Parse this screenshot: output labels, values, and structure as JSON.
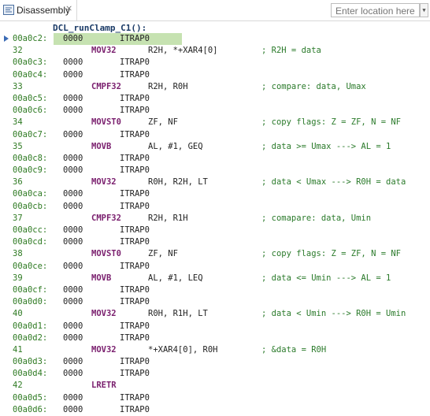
{
  "tab": {
    "label": "Disassembly",
    "close_icon": "close-icon"
  },
  "location": {
    "placeholder": "Enter location here"
  },
  "function_label": "DCL_runClamp_C1():",
  "colors": {
    "address": "#2e7a22",
    "mnemonic": "#7a1f6e",
    "comment": "#2a7a2a",
    "highlight": "#c6e2b1"
  },
  "rows": [
    {
      "kind": "addr",
      "text": "00a0c2:",
      "op": "0000",
      "instr": "ITRAP0",
      "current": true
    },
    {
      "kind": "src",
      "text": "32",
      "mn": "MOV32",
      "args": "R2H, *+XAR4[0]",
      "cmt": "; R2H = data"
    },
    {
      "kind": "addr",
      "text": "00a0c3:",
      "op": "0000",
      "instr": "ITRAP0"
    },
    {
      "kind": "addr",
      "text": "00a0c4:",
      "op": "0000",
      "instr": "ITRAP0"
    },
    {
      "kind": "src",
      "text": "33",
      "mn": "CMPF32",
      "args": "R2H, R0H",
      "cmt": "; compare: data, Umax"
    },
    {
      "kind": "addr",
      "text": "00a0c5:",
      "op": "0000",
      "instr": "ITRAP0"
    },
    {
      "kind": "addr",
      "text": "00a0c6:",
      "op": "0000",
      "instr": "ITRAP0"
    },
    {
      "kind": "src",
      "text": "34",
      "mn": "MOVST0",
      "args": "ZF, NF",
      "cmt": "; copy flags: Z = ZF, N = NF"
    },
    {
      "kind": "addr",
      "text": "00a0c7:",
      "op": "0000",
      "instr": "ITRAP0"
    },
    {
      "kind": "src",
      "text": "35",
      "mn": "MOVB",
      "args": "AL, #1, GEQ",
      "cmt": "; data >= Umax ---> AL = 1"
    },
    {
      "kind": "addr",
      "text": "00a0c8:",
      "op": "0000",
      "instr": "ITRAP0"
    },
    {
      "kind": "addr",
      "text": "00a0c9:",
      "op": "0000",
      "instr": "ITRAP0"
    },
    {
      "kind": "src",
      "text": "36",
      "mn": "MOV32",
      "args": "R0H, R2H, LT",
      "cmt": "; data < Umax ---> R0H = data"
    },
    {
      "kind": "addr",
      "text": "00a0ca:",
      "op": "0000",
      "instr": "ITRAP0"
    },
    {
      "kind": "addr",
      "text": "00a0cb:",
      "op": "0000",
      "instr": "ITRAP0"
    },
    {
      "kind": "src",
      "text": "37",
      "mn": "CMPF32",
      "args": "R2H, R1H",
      "cmt": "; comapare: data, Umin"
    },
    {
      "kind": "addr",
      "text": "00a0cc:",
      "op": "0000",
      "instr": "ITRAP0"
    },
    {
      "kind": "addr",
      "text": "00a0cd:",
      "op": "0000",
      "instr": "ITRAP0"
    },
    {
      "kind": "src",
      "text": "38",
      "mn": "MOVST0",
      "args": "ZF, NF",
      "cmt": "; copy flags: Z = ZF, N = NF"
    },
    {
      "kind": "addr",
      "text": "00a0ce:",
      "op": "0000",
      "instr": "ITRAP0"
    },
    {
      "kind": "src",
      "text": "39",
      "mn": "MOVB",
      "args": "AL, #1, LEQ",
      "cmt": "; data <= Umin ---> AL = 1"
    },
    {
      "kind": "addr",
      "text": "00a0cf:",
      "op": "0000",
      "instr": "ITRAP0"
    },
    {
      "kind": "addr",
      "text": "00a0d0:",
      "op": "0000",
      "instr": "ITRAP0"
    },
    {
      "kind": "src",
      "text": "40",
      "mn": "MOV32",
      "args": "R0H, R1H, LT",
      "cmt": "; data < Umin ---> R0H = Umin"
    },
    {
      "kind": "addr",
      "text": "00a0d1:",
      "op": "0000",
      "instr": "ITRAP0"
    },
    {
      "kind": "addr",
      "text": "00a0d2:",
      "op": "0000",
      "instr": "ITRAP0"
    },
    {
      "kind": "src",
      "text": "41",
      "mn": "MOV32",
      "args": "*+XAR4[0], R0H",
      "cmt": "; &data = R0H"
    },
    {
      "kind": "addr",
      "text": "00a0d3:",
      "op": "0000",
      "instr": "ITRAP0"
    },
    {
      "kind": "addr",
      "text": "00a0d4:",
      "op": "0000",
      "instr": "ITRAP0"
    },
    {
      "kind": "src",
      "text": "42",
      "mn": "LRETR",
      "args": "",
      "cmt": ""
    },
    {
      "kind": "addr",
      "text": "00a0d5:",
      "op": "0000",
      "instr": "ITRAP0"
    },
    {
      "kind": "addr",
      "text": "00a0d6:",
      "op": "0000",
      "instr": "ITRAP0"
    }
  ]
}
